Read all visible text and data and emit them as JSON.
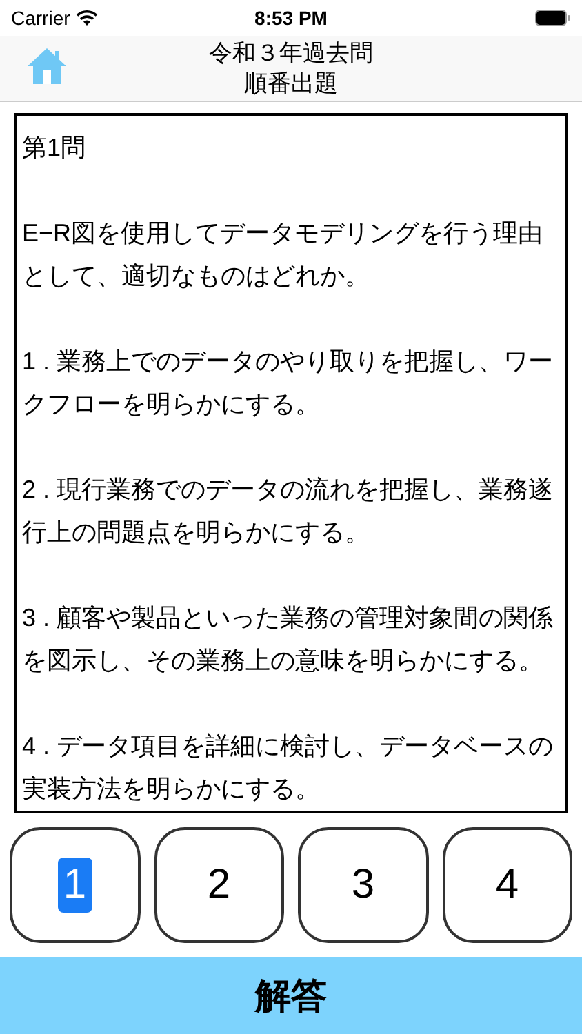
{
  "status_bar": {
    "carrier": "Carrier",
    "time": "8:53 PM"
  },
  "nav": {
    "title": "令和３年過去問",
    "subtitle": "順番出題"
  },
  "question": {
    "number": "第1問",
    "text": "E−R図を使用してデータモデリングを行う理由として、適切なものはどれか。",
    "choices": [
      "1 . 業務上でのデータのやり取りを把握し、ワークフローを明らかにする。",
      "2 . 現行業務でのデータの流れを把握し、業務遂行上の問題点を明らかにする。",
      "3 . 顧客や製品といった業務の管理対象間の関係を図示し、その業務上の意味を明らかにする。",
      "4 . データ項目を詳細に検討し、データベースの実装方法を明らかにする。"
    ]
  },
  "answers": [
    {
      "label": "1",
      "selected": true
    },
    {
      "label": "2",
      "selected": false
    },
    {
      "label": "3",
      "selected": false
    },
    {
      "label": "4",
      "selected": false
    }
  ],
  "submit": "解答"
}
